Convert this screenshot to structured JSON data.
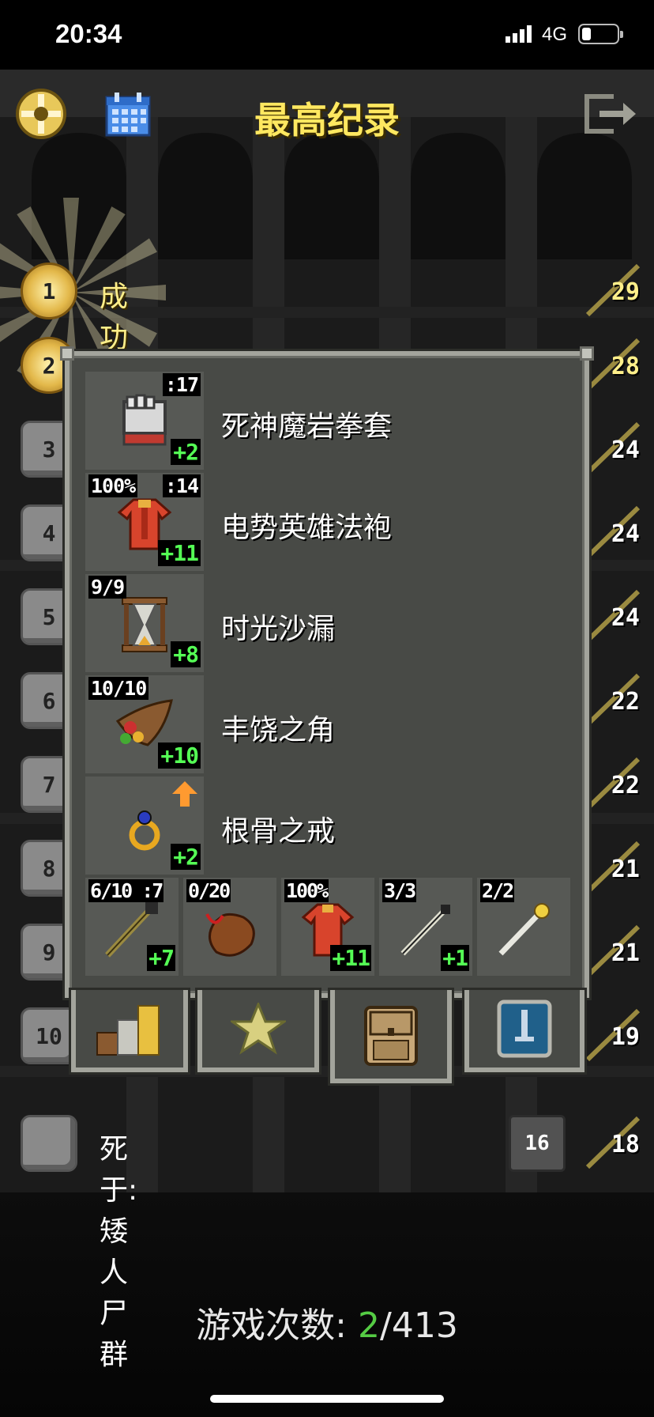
{
  "status_bar": {
    "time": "20:34",
    "network": "4G",
    "battery_level": 0.2
  },
  "header": {
    "title": "最高纪录",
    "menu_icon": "menu-icon",
    "journal_icon": "calendar-icon",
    "exit_icon": "exit-icon"
  },
  "records": [
    {
      "rank": "1",
      "text": "成功携带护身符回到地面!",
      "score": "29",
      "win": true
    },
    {
      "rank": "2",
      "score": "28",
      "win": true
    },
    {
      "rank": "3",
      "score": "24"
    },
    {
      "rank": "4",
      "score": "24"
    },
    {
      "rank": "5",
      "score": "24"
    },
    {
      "rank": "6",
      "score": "22"
    },
    {
      "rank": "7",
      "score": "22"
    },
    {
      "rank": "8",
      "score": "21"
    },
    {
      "rank": "9",
      "score": "21"
    },
    {
      "rank": "10",
      "score": "19"
    },
    {
      "rank": "",
      "text": "死于:  矮人尸群",
      "depth": "16",
      "score": "18"
    }
  ],
  "equipment": [
    {
      "name": "死神魔岩拳套",
      "top_left": "",
      "top_right": ":17",
      "bonus": "+2",
      "icon": "gauntlet-icon",
      "upgrade_arrow": false
    },
    {
      "name": "电势英雄法袍",
      "top_left": "100%",
      "top_right": ":14",
      "bonus": "+11",
      "icon": "robe-icon",
      "upgrade_arrow": false
    },
    {
      "name": "时光沙漏",
      "top_left": "9/9",
      "top_right": "",
      "bonus": "+8",
      "icon": "hourglass-icon",
      "upgrade_arrow": false
    },
    {
      "name": "丰饶之角",
      "top_left": "10/10",
      "top_right": "",
      "bonus": "+10",
      "icon": "horn-of-plenty-icon",
      "upgrade_arrow": false
    },
    {
      "name": "根骨之戒",
      "top_left": "",
      "top_right": "",
      "bonus": "+2",
      "icon": "ring-icon",
      "upgrade_arrow": true
    }
  ],
  "quickslots": [
    {
      "top_left": "6/10 :7",
      "bonus": "+7",
      "icon": "staff-icon"
    },
    {
      "top_left": "0/20",
      "bonus": "",
      "icon": "waterskin-icon"
    },
    {
      "top_left": "100%",
      "bonus": "+11",
      "icon": "robe-icon"
    },
    {
      "top_left": "3/3",
      "bonus": "+1",
      "icon": "wand-icon"
    },
    {
      "top_left": "2/2",
      "bonus": "",
      "icon": "magic-wand-icon"
    }
  ],
  "tabs": [
    {
      "icon": "stats-icon",
      "active": false
    },
    {
      "icon": "badges-star-icon",
      "active": false
    },
    {
      "icon": "backpack-icon",
      "active": true
    },
    {
      "icon": "challenges-icon",
      "active": false
    }
  ],
  "games_played": {
    "label": "游戏次数:",
    "current": "2",
    "total": "/413"
  },
  "colors": {
    "title": "#ffe860",
    "panel": "#484a46",
    "panel_border": "#a3a49c",
    "bonus": "#55ff55",
    "games_current": "#55cc44"
  }
}
